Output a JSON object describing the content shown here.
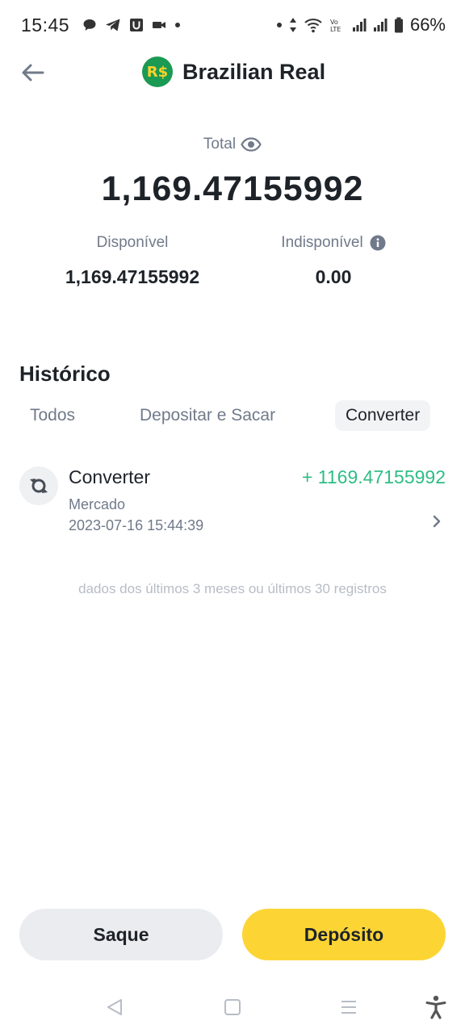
{
  "status_bar": {
    "time": "15:45",
    "battery": "66%",
    "icons": [
      "chat-icon",
      "telegram-icon",
      "u-app-icon",
      "video-icon",
      "dot-icon",
      "dot-icon",
      "data-arrows-icon",
      "wifi-icon",
      "volte-icon",
      "signal-icon",
      "signal-icon",
      "battery-icon"
    ]
  },
  "header": {
    "title": "Brazilian Real",
    "coin_symbol": "R$"
  },
  "balance": {
    "total_label": "Total",
    "total_value": "1,169.47155992",
    "available_label": "Disponível",
    "available_value": "1,169.47155992",
    "unavailable_label": "Indisponível",
    "unavailable_value": "0.00"
  },
  "history": {
    "title": "Histórico",
    "tabs": [
      {
        "label": "Todos"
      },
      {
        "label": "Depositar e Sacar"
      },
      {
        "label": "Converter"
      }
    ],
    "selected_tab": "Converter",
    "transactions": [
      {
        "type": "Converter",
        "subtitle": "Mercado",
        "datetime": "2023-07-16 15:44:39",
        "amount": "+ 1169.47155992"
      }
    ],
    "footer_note": "dados dos últimos 3 meses ou últimos 30 registros"
  },
  "actions": {
    "withdraw_label": "Saque",
    "deposit_label": "Depósito"
  },
  "colors": {
    "accent_yellow": "#fcd535",
    "positive_green": "#2ebd85",
    "muted_text": "#707a8a",
    "coin_green": "#1a9a52"
  }
}
